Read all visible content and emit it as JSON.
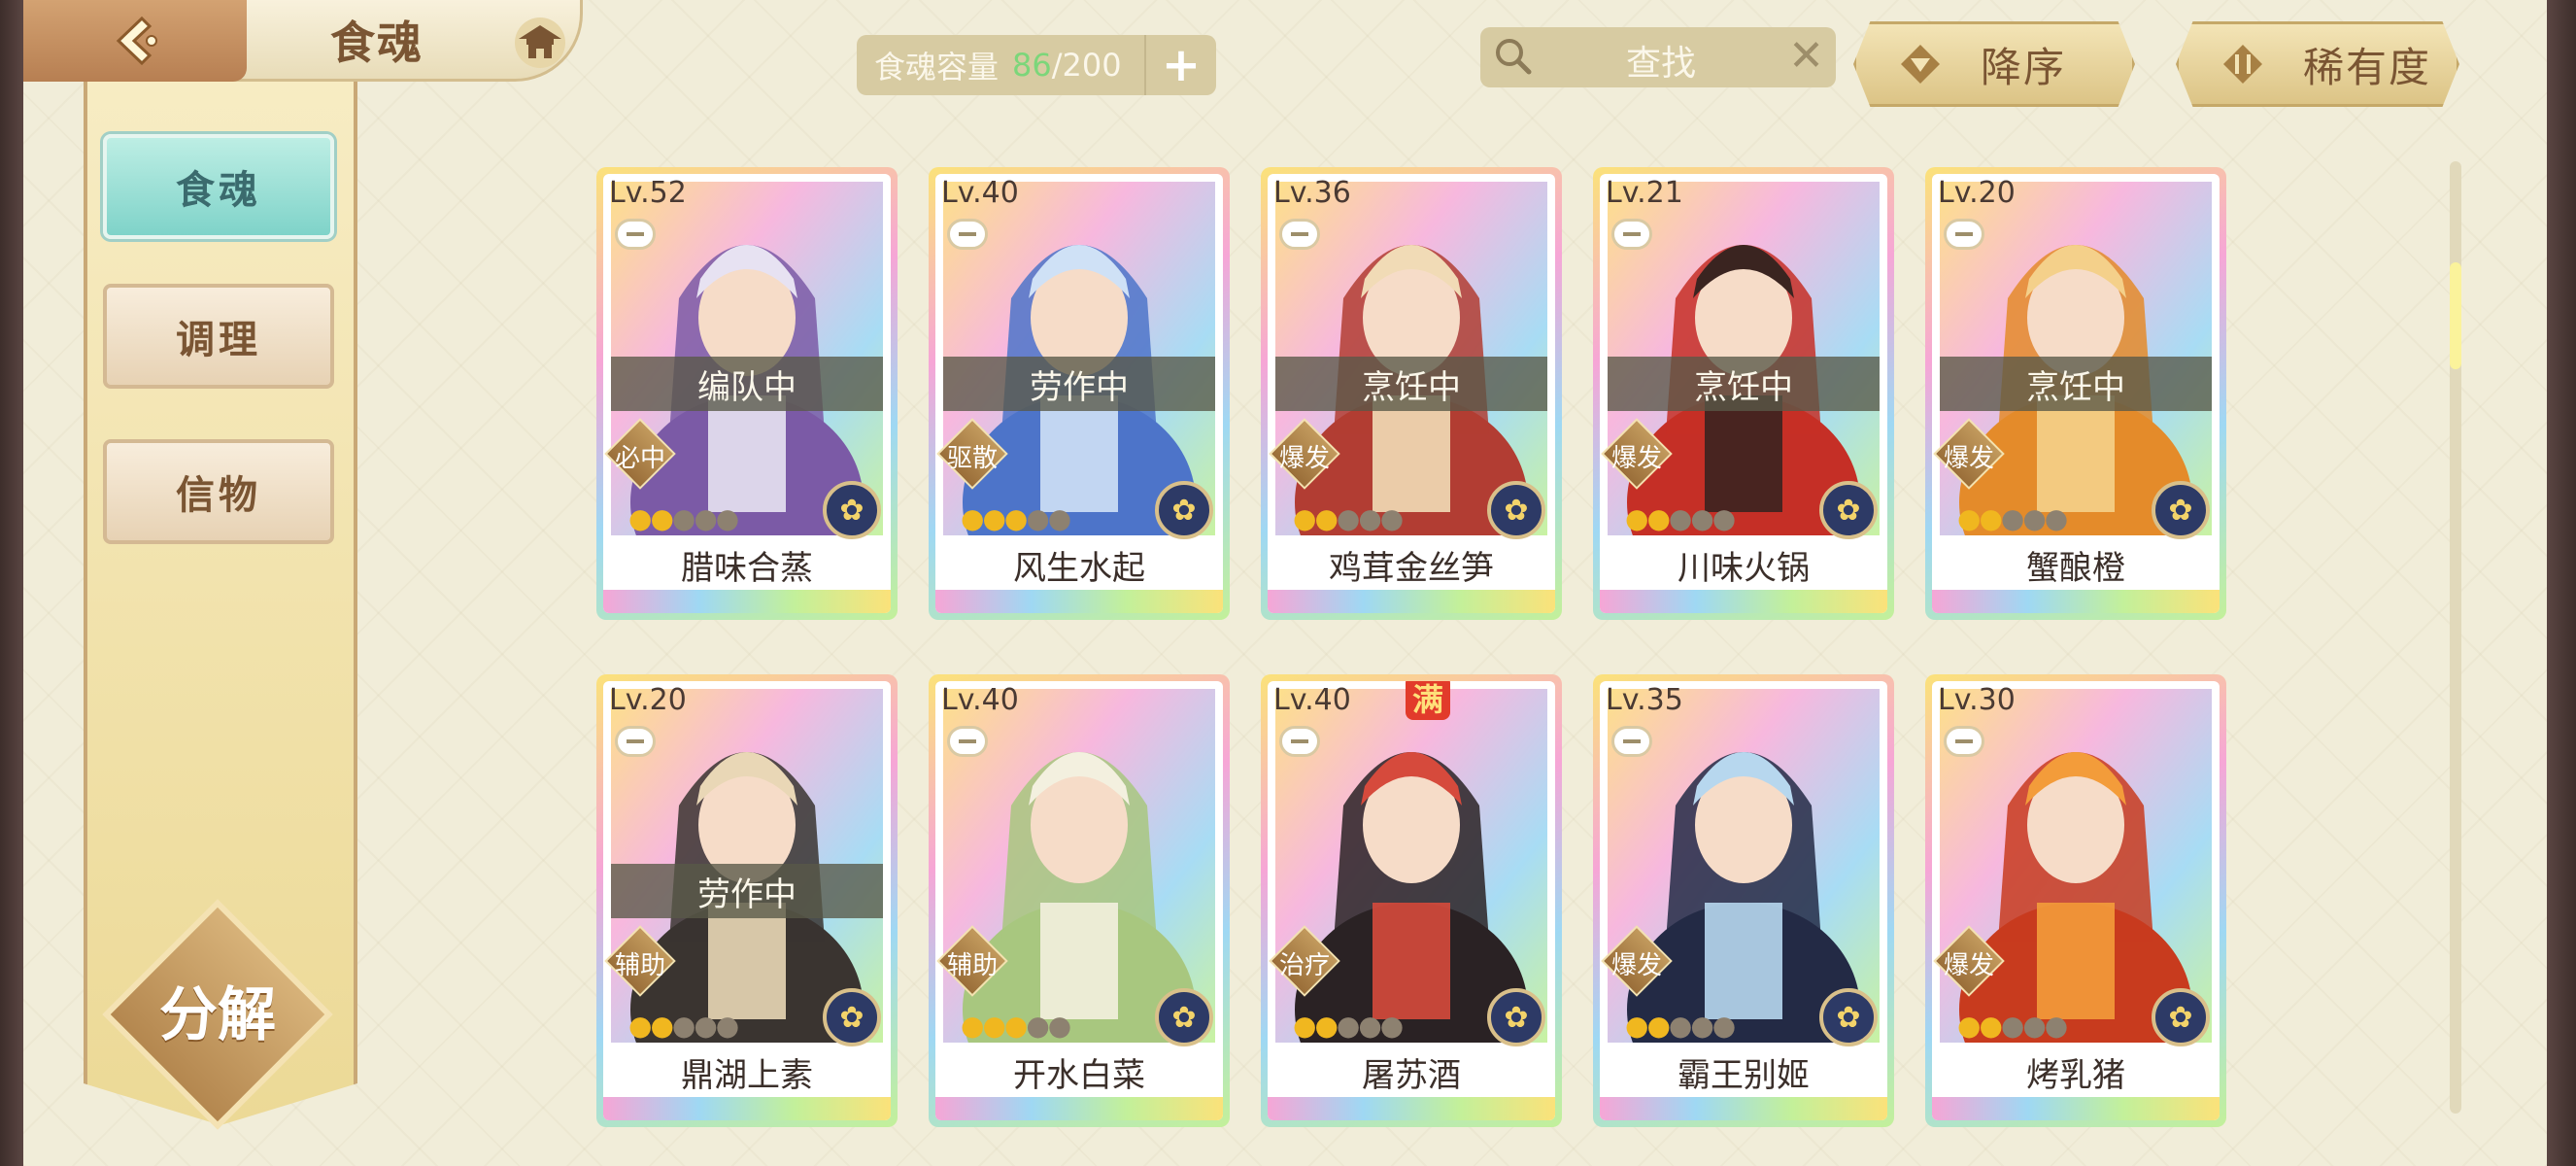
{
  "header": {
    "title": "食魂",
    "capacity_label": "食魂容量",
    "capacity_current": "86",
    "capacity_max": "/200",
    "capacity_add": "+",
    "search_placeholder": "查找",
    "search_clear": "✕",
    "sort_label": "降序",
    "rarity_label": "稀有度"
  },
  "sidebar": {
    "tabs": [
      {
        "label": "食魂",
        "active": true
      },
      {
        "label": "调理",
        "active": false
      },
      {
        "label": "信物",
        "active": false
      }
    ],
    "decompose_label": "分解"
  },
  "cards": [
    {
      "level": "Lv.52",
      "status": "编队中",
      "role": "必中",
      "stars_on": 2,
      "stars_total": 5,
      "name": "腊味合蒸",
      "maxed": false,
      "palette": [
        "#7b5aa6",
        "#e7e2f2"
      ]
    },
    {
      "level": "Lv.40",
      "status": "劳作中",
      "role": "驱散",
      "stars_on": 3,
      "stars_total": 5,
      "name": "风生水起",
      "maxed": false,
      "palette": [
        "#4d74c9",
        "#cfe1f6"
      ]
    },
    {
      "level": "Lv.36",
      "status": "烹饪中",
      "role": "爆发",
      "stars_on": 2,
      "stars_total": 5,
      "name": "鸡茸金丝笋",
      "maxed": false,
      "palette": [
        "#b23d33",
        "#f1dbb6"
      ]
    },
    {
      "level": "Lv.21",
      "status": "烹饪中",
      "role": "爆发",
      "stars_on": 2,
      "stars_total": 5,
      "name": "川味火锅",
      "maxed": false,
      "palette": [
        "#c52f26",
        "#3a2420"
      ]
    },
    {
      "level": "Lv.20",
      "status": "烹饪中",
      "role": "爆发",
      "stars_on": 2,
      "stars_total": 5,
      "name": "蟹酿橙",
      "maxed": false,
      "palette": [
        "#e48b2a",
        "#f4d08a"
      ]
    },
    {
      "level": "Lv.20",
      "status": "劳作中",
      "role": "辅助",
      "stars_on": 2,
      "stars_total": 5,
      "name": "鼎湖上素",
      "maxed": false,
      "palette": [
        "#3a3430",
        "#e9d7b6"
      ]
    },
    {
      "level": "Lv.40",
      "status": "",
      "role": "辅助",
      "stars_on": 3,
      "stars_total": 5,
      "name": "开水白菜",
      "maxed": false,
      "palette": [
        "#a8c77f",
        "#f3f0df"
      ]
    },
    {
      "level": "Lv.40",
      "status": "",
      "role": "治疗",
      "stars_on": 2,
      "stars_total": 5,
      "name": "屠苏酒",
      "maxed": true,
      "max_label": "满",
      "palette": [
        "#2a2224",
        "#d64a3c"
      ]
    },
    {
      "level": "Lv.35",
      "status": "",
      "role": "爆发",
      "stars_on": 2,
      "stars_total": 5,
      "name": "霸王别姬",
      "maxed": false,
      "palette": [
        "#232a45",
        "#b7d7ee"
      ]
    },
    {
      "level": "Lv.30",
      "status": "",
      "role": "爆发",
      "stars_on": 2,
      "stars_total": 5,
      "name": "烤乳猪",
      "maxed": false,
      "palette": [
        "#c83b1e",
        "#f39c3a"
      ]
    }
  ],
  "icons": {
    "back": "back-arrow-icon",
    "house": "pagoda-icon",
    "search": "magnifier-icon",
    "sort": "triangle-down-icon",
    "rarity": "rarity-filter-icon"
  }
}
